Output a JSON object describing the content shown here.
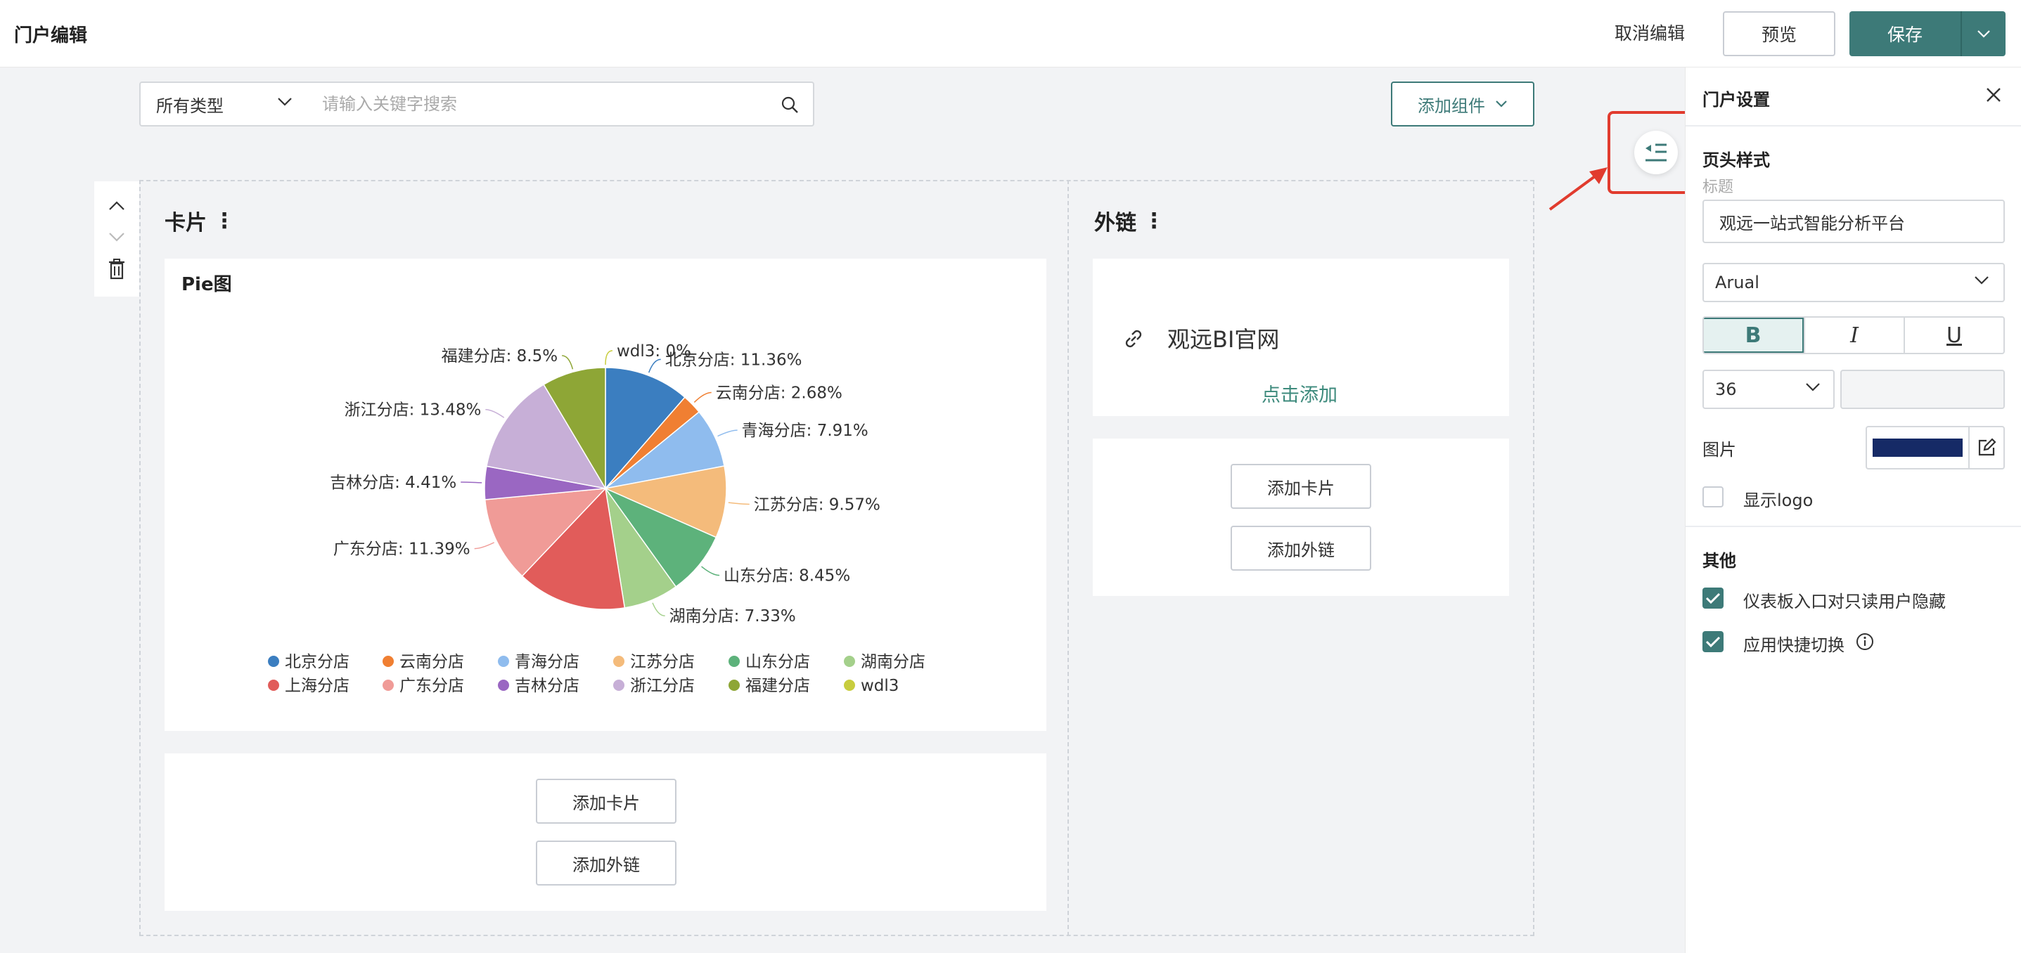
{
  "header": {
    "title": "门户编辑",
    "cancel_label": "取消编辑",
    "preview_label": "预览",
    "save_label": "保存"
  },
  "toolbar": {
    "type_filter": "所有类型",
    "search_placeholder": "请输入关键字搜索",
    "add_component_label": "添加组件"
  },
  "left_column": {
    "title": "卡片",
    "chart_card_title": "Pie图",
    "add_card_label": "添加卡片",
    "add_link_label": "添加外链"
  },
  "right_column": {
    "title": "外链",
    "link_text": "观远BI官网",
    "link_add": "点击添加",
    "add_card_label": "添加卡片",
    "add_link_label": "添加外链"
  },
  "chart_data": {
    "type": "pie",
    "title": "Pie图",
    "slices": [
      {
        "name": "北京分店",
        "value": 11.36,
        "label": "北京分店: 11.36%",
        "color": "#3b7ec0"
      },
      {
        "name": "云南分店",
        "value": 2.68,
        "label": "云南分店: 2.68%",
        "color": "#f07f32"
      },
      {
        "name": "青海分店",
        "value": 7.91,
        "label": "青海分店: 7.91%",
        "color": "#8fbcee"
      },
      {
        "name": "江苏分店",
        "value": 9.57,
        "label": "江苏分店: 9.57%",
        "color": "#f4bb7b"
      },
      {
        "name": "山东分店",
        "value": 8.45,
        "label": "山东分店: 8.45%",
        "color": "#5db27b"
      },
      {
        "name": "湖南分店",
        "value": 7.33,
        "label": "湖南分店: 7.33%",
        "color": "#a4d08b"
      },
      {
        "name": "上海分店",
        "value": 14.58,
        "label": "",
        "color": "#e15c5a"
      },
      {
        "name": "广东分店",
        "value": 11.39,
        "label": "广东分店: 11.39%",
        "color": "#f09b97"
      },
      {
        "name": "吉林分店",
        "value": 4.41,
        "label": "吉林分店: 4.41%",
        "color": "#9a67c2"
      },
      {
        "name": "浙江分店",
        "value": 13.48,
        "label": "浙江分店: 13.48%",
        "color": "#c7afd7"
      },
      {
        "name": "福建分店",
        "value": 8.5,
        "label": "福建分店: 8.5%",
        "color": "#8ea636"
      },
      {
        "name": "wdl3",
        "value": 0,
        "label": "wdl3: 0%",
        "color": "#c8cd3e"
      }
    ],
    "legend": [
      "北京分店",
      "云南分店",
      "青海分店",
      "江苏分店",
      "山东分店",
      "湖南分店",
      "上海分店",
      "广东分店",
      "吉林分店",
      "浙江分店",
      "福建分店",
      "wdl3"
    ]
  },
  "panel": {
    "title": "门户设置",
    "header_style_label": "页头样式",
    "title_label": "标题",
    "title_value": "观远一站式智能分析平台",
    "font_value": "Arual",
    "bold": "B",
    "italic": "I",
    "underline": "U",
    "font_size": "36",
    "image_label": "图片",
    "show_logo_label": "显示logo",
    "other_label": "其他",
    "hide_dashboard_label": "仪表板入口对只读用户隐藏",
    "quick_switch_label": "应用快捷切换"
  },
  "colors": {
    "accent": "#3d7a78",
    "highlight": "#e13b2e"
  }
}
